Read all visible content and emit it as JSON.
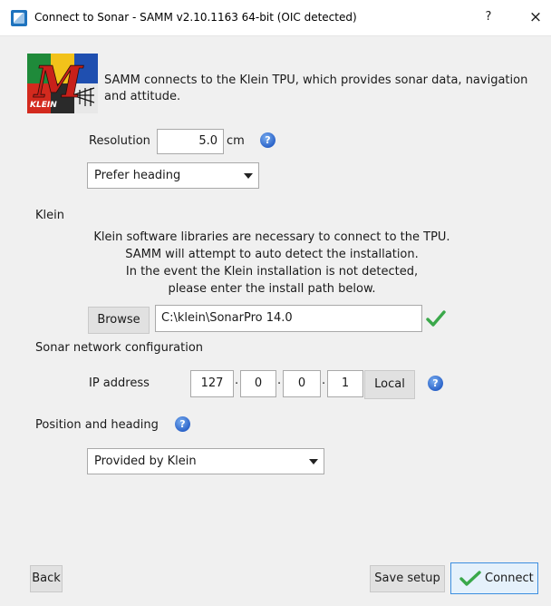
{
  "window": {
    "title": "Connect to Sonar - SAMM v2.10.1163 64-bit (OIC detected)",
    "help_label": "?",
    "close_label": "×"
  },
  "logo": {
    "letter": "M",
    "text": "KLEIN"
  },
  "intro": {
    "text": "SAMM connects to the Klein TPU, which provides sonar data, navigation and attitude."
  },
  "resolution": {
    "label": "Resolution",
    "value": "5.0",
    "unit": "cm"
  },
  "heading_mode": {
    "selected": "Prefer heading"
  },
  "klein": {
    "section_label": "Klein",
    "description_lines": [
      "Klein software libraries are necessary to connect to the TPU.",
      "SAMM will attempt to auto detect the installation.",
      "In the event the Klein installation is not detected,",
      "please enter the install path below."
    ],
    "browse_label": "Browse",
    "install_path": "C:\\klein\\SonarPro 14.0",
    "path_valid": true
  },
  "network": {
    "section_label": "Sonar network configuration",
    "ip_label": "IP address",
    "octets": [
      "127",
      "0",
      "0",
      "1"
    ],
    "dot": ".",
    "local_label": "Local"
  },
  "position": {
    "section_label": "Position and heading",
    "selected": "Provided by Klein"
  },
  "footer": {
    "back_label": "Back",
    "save_label": "Save setup",
    "connect_label": "Connect"
  },
  "icons": {
    "help": "?"
  },
  "colors": {
    "accent": "#2c64c9",
    "check": "#3aa84a",
    "connect_border": "#3c8ee0",
    "connect_bg": "#e5f1fb"
  }
}
